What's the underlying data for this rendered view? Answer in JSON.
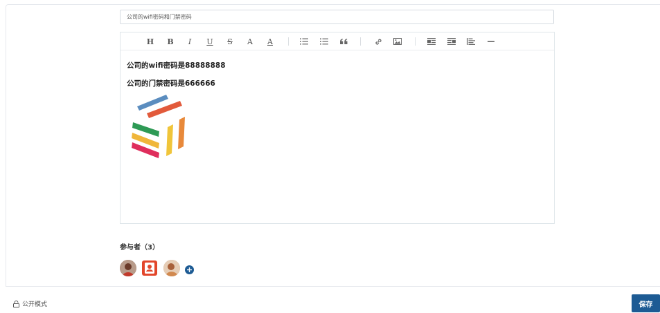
{
  "title_field": {
    "value": "公司的wifi密码和门禁密码"
  },
  "toolbar": {
    "heading": "H",
    "bold": "B",
    "italic": "I",
    "underline": "U",
    "strike": "S",
    "font_color": "A",
    "bg_color": "A"
  },
  "content": {
    "line1": "公司的wifi密码是88888888",
    "line2": "公司的门禁密码是666666"
  },
  "participants": {
    "title": "参与者（3）"
  },
  "footer": {
    "public_mode": "公开模式",
    "save": "保存"
  },
  "colors": {
    "accent": "#1d5b94",
    "logo_blue": "#5b8dbf",
    "logo_red": "#e25a3b",
    "logo_green": "#2e9a55",
    "logo_pink": "#df2e5c",
    "logo_yellow": "#f0c53a",
    "logo_orange": "#e8893a"
  }
}
